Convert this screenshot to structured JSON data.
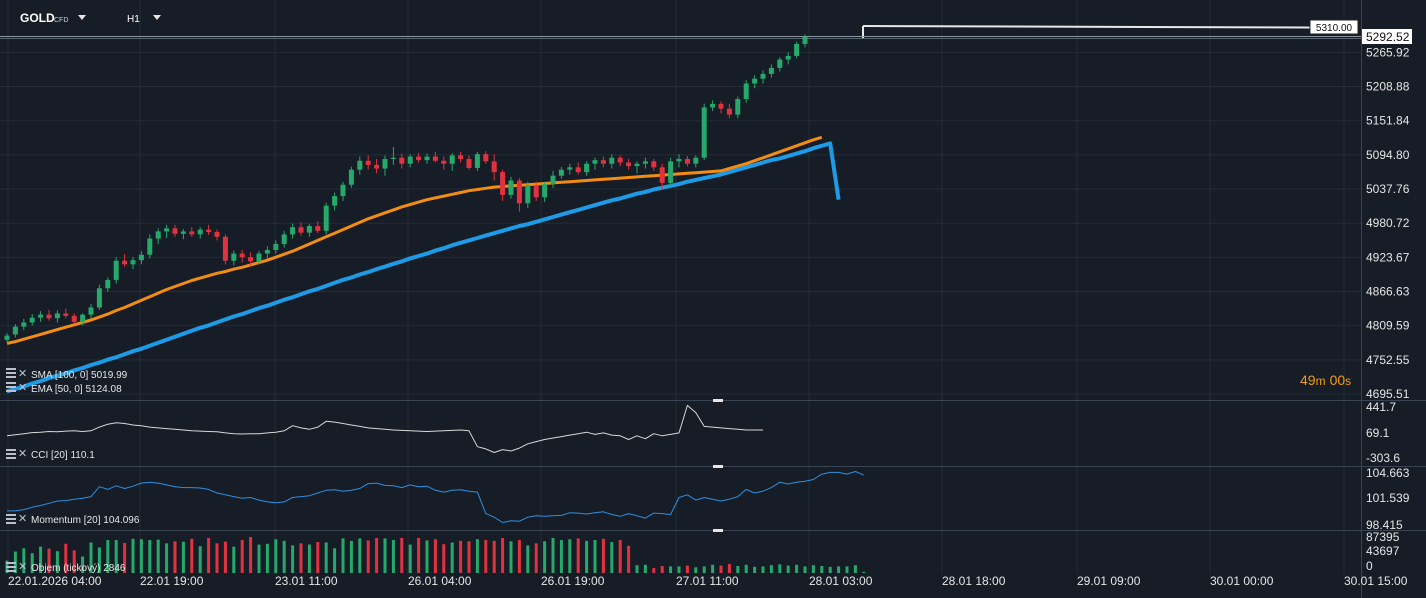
{
  "toolbar": {
    "symbol": "GOLD",
    "symbol_type": "CFD",
    "timeframe": "H1"
  },
  "colors": {
    "background": "#161d26",
    "grid": "#232c37",
    "bull": "#26a96b",
    "bear": "#e3323f",
    "sma": "#1e9be6",
    "ema": "#f38d12",
    "cci": "#d8d8d8",
    "momentum": "#2f8fe0",
    "countdown": "#f39c12"
  },
  "price_axis": {
    "ticks": [
      "5265.92",
      "5208.88",
      "5151.84",
      "5094.80",
      "5037.76",
      "4980.72",
      "4923.67",
      "4866.63",
      "4809.59",
      "4752.55",
      "4695.51"
    ],
    "current_price": "5292.52",
    "line_label": "5310.00"
  },
  "countdown": {
    "minutes": "49",
    "m": "m",
    "seconds": "00",
    "s": "s"
  },
  "indicators": {
    "sma": {
      "name": "SMA",
      "params": "[100,  0]",
      "value": "5019.99"
    },
    "ema": {
      "name": "EMA",
      "params": "[50,  0]",
      "value": "5124.08"
    },
    "cci": {
      "name": "CCI",
      "params": "[20]",
      "value": "110.1",
      "axis": [
        "441.7",
        "69.1",
        "-303.6"
      ]
    },
    "momentum": {
      "name": "Momentum",
      "params": "[20]",
      "value": "104.096",
      "axis": [
        "104.663",
        "101.539",
        "98.415"
      ]
    },
    "volume": {
      "name": "Objem  (tickový)",
      "value": "2846",
      "axis": [
        "87395",
        "43697",
        "0"
      ]
    }
  },
  "time_axis": [
    "22.01.2026  04:00",
    "22.01  19:00",
    "23.01  11:00",
    "26.01  04:00",
    "26.01  19:00",
    "27.01  11:00",
    "28.01  03:00",
    "28.01  18:00",
    "29.01  09:00",
    "30.01  00:00",
    "30.01  15:00"
  ],
  "chart_data": {
    "type": "candlestick",
    "ylim": [
      4695.51,
      5310.0
    ],
    "candles_ohlc": [
      [
        4786,
        4797,
        4782,
        4793
      ],
      [
        4795,
        4812,
        4790,
        4808
      ],
      [
        4808,
        4821,
        4802,
        4815
      ],
      [
        4815,
        4829,
        4810,
        4823
      ],
      [
        4823,
        4834,
        4816,
        4828
      ],
      [
        4828,
        4836,
        4818,
        4822
      ],
      [
        4822,
        4835,
        4815,
        4830
      ],
      [
        4830,
        4838,
        4822,
        4826
      ],
      [
        4826,
        4830,
        4812,
        4816
      ],
      [
        4816,
        4830,
        4810,
        4828
      ],
      [
        4828,
        4846,
        4822,
        4840
      ],
      [
        4840,
        4878,
        4836,
        4872
      ],
      [
        4872,
        4890,
        4866,
        4886
      ],
      [
        4886,
        4924,
        4880,
        4918
      ],
      [
        4918,
        4929,
        4908,
        4912
      ],
      [
        4912,
        4924,
        4904,
        4919
      ],
      [
        4919,
        4934,
        4912,
        4928
      ],
      [
        4928,
        4962,
        4922,
        4955
      ],
      [
        4955,
        4972,
        4946,
        4967
      ],
      [
        4967,
        4978,
        4956,
        4972
      ],
      [
        4972,
        4978,
        4958,
        4963
      ],
      [
        4963,
        4971,
        4954,
        4967
      ],
      [
        4967,
        4974,
        4958,
        4962
      ],
      [
        4962,
        4974,
        4955,
        4970
      ],
      [
        4970,
        4978,
        4961,
        4966
      ],
      [
        4966,
        4970,
        4952,
        4958
      ],
      [
        4958,
        4962,
        4912,
        4918
      ],
      [
        4918,
        4935,
        4910,
        4930
      ],
      [
        4930,
        4936,
        4915,
        4924
      ],
      [
        4924,
        4932,
        4910,
        4917
      ],
      [
        4917,
        4934,
        4912,
        4930
      ],
      [
        4930,
        4942,
        4921,
        4936
      ],
      [
        4936,
        4952,
        4930,
        4946
      ],
      [
        4946,
        4968,
        4940,
        4962
      ],
      [
        4962,
        4980,
        4955,
        4974
      ],
      [
        4974,
        4982,
        4960,
        4965
      ],
      [
        4965,
        4980,
        4958,
        4976
      ],
      [
        4976,
        4984,
        4964,
        4968
      ],
      [
        4968,
        5015,
        4962,
        5010
      ],
      [
        5010,
        5032,
        5002,
        5026
      ],
      [
        5026,
        5050,
        5018,
        5045
      ],
      [
        5045,
        5075,
        5040,
        5070
      ],
      [
        5070,
        5092,
        5062,
        5085
      ],
      [
        5085,
        5094,
        5070,
        5078
      ],
      [
        5078,
        5088,
        5064,
        5072
      ],
      [
        5072,
        5094,
        5060,
        5088
      ],
      [
        5088,
        5108,
        5078,
        5090
      ],
      [
        5090,
        5097,
        5072,
        5080
      ],
      [
        5080,
        5096,
        5074,
        5092
      ],
      [
        5092,
        5098,
        5082,
        5086
      ],
      [
        5086,
        5097,
        5080,
        5092
      ],
      [
        5092,
        5100,
        5082,
        5085
      ],
      [
        5085,
        5092,
        5070,
        5080
      ],
      [
        5080,
        5098,
        5068,
        5094
      ],
      [
        5094,
        5100,
        5082,
        5088
      ],
      [
        5088,
        5094,
        5070,
        5073
      ],
      [
        5073,
        5100,
        5068,
        5096
      ],
      [
        5096,
        5101,
        5080,
        5084
      ],
      [
        5084,
        5096,
        5052,
        5066
      ],
      [
        5066,
        5070,
        5018,
        5028
      ],
      [
        5028,
        5058,
        5022,
        5052
      ],
      [
        5052,
        5056,
        5000,
        5014
      ],
      [
        5014,
        5050,
        5006,
        5044
      ],
      [
        5044,
        5050,
        5018,
        5024
      ],
      [
        5024,
        5050,
        5016,
        5046
      ],
      [
        5046,
        5068,
        5040,
        5060
      ],
      [
        5060,
        5075,
        5055,
        5070
      ],
      [
        5070,
        5080,
        5062,
        5074
      ],
      [
        5074,
        5082,
        5062,
        5066
      ],
      [
        5066,
        5084,
        5060,
        5080
      ],
      [
        5080,
        5090,
        5070,
        5086
      ],
      [
        5086,
        5092,
        5074,
        5080
      ],
      [
        5080,
        5096,
        5072,
        5090
      ],
      [
        5090,
        5094,
        5076,
        5082
      ],
      [
        5082,
        5088,
        5070,
        5076
      ],
      [
        5076,
        5084,
        5064,
        5080
      ],
      [
        5080,
        5090,
        5072,
        5084
      ],
      [
        5084,
        5088,
        5068,
        5074
      ],
      [
        5074,
        5080,
        5038,
        5048
      ],
      [
        5048,
        5090,
        5044,
        5084
      ],
      [
        5084,
        5096,
        5074,
        5088
      ],
      [
        5088,
        5093,
        5076,
        5080
      ],
      [
        5080,
        5094,
        5074,
        5090
      ],
      [
        5090,
        5180,
        5086,
        5174
      ],
      [
        5174,
        5186,
        5168,
        5180
      ],
      [
        5180,
        5184,
        5164,
        5172
      ],
      [
        5172,
        5180,
        5156,
        5162
      ],
      [
        5162,
        5192,
        5156,
        5188
      ],
      [
        5188,
        5220,
        5182,
        5214
      ],
      [
        5214,
        5228,
        5206,
        5222
      ],
      [
        5222,
        5236,
        5214,
        5230
      ],
      [
        5230,
        5246,
        5224,
        5240
      ],
      [
        5240,
        5258,
        5234,
        5254
      ],
      [
        5254,
        5266,
        5246,
        5260
      ],
      [
        5260,
        5284,
        5256,
        5280
      ],
      [
        5280,
        5296,
        5274,
        5292
      ]
    ],
    "series": [
      {
        "name": "SMA [100,  0]",
        "values": [
          4700,
          4704,
          4708,
          4713,
          4717,
          4722,
          4726,
          4730,
          4735,
          4739,
          4744,
          4748,
          4753,
          4757,
          4762,
          4767,
          4771,
          4776,
          4781,
          4786,
          4791,
          4796,
          4801,
          4806,
          4810,
          4815,
          4820,
          4825,
          4829,
          4834,
          4839,
          4843,
          4848,
          4853,
          4857,
          4862,
          4867,
          4871,
          4876,
          4881,
          4886,
          4890,
          4895,
          4899,
          4904,
          4908,
          4913,
          4917,
          4922,
          4926,
          4930,
          4935,
          4939,
          4944,
          4948,
          4952,
          4956,
          4960,
          4964,
          4968,
          4972,
          4976,
          4979,
          4983,
          4987,
          4991,
          4995,
          4999,
          5003,
          5007,
          5011,
          5015,
          5019,
          5022,
          5026,
          5030,
          5033,
          5037,
          5040,
          5043,
          5046,
          5050,
          5053,
          5056,
          5059,
          5062,
          5066,
          5070,
          5074,
          5078,
          5082,
          5086,
          5089,
          5093,
          5097,
          5101,
          5106,
          5110,
          5114,
          5019.99
        ]
      },
      {
        "name": "EMA [50,  0]",
        "values": [
          4780,
          4783,
          4787,
          4791,
          4795,
          4799,
          4803,
          4807,
          4811,
          4815,
          4819,
          4824,
          4829,
          4835,
          4840,
          4846,
          4852,
          4858,
          4864,
          4870,
          4875,
          4880,
          4885,
          4889,
          4893,
          4897,
          4900,
          4904,
          4907,
          4911,
          4915,
          4919,
          4924,
          4929,
          4934,
          4940,
          4946,
          4952,
          4958,
          4964,
          4970,
          4976,
          4982,
          4988,
          4993,
          4998,
          5003,
          5008,
          5012,
          5016,
          5020,
          5023,
          5026,
          5029,
          5032,
          5035,
          5037,
          5039,
          5041,
          5042,
          5043,
          5044,
          5045,
          5046,
          5047,
          5048,
          5049,
          5050,
          5051,
          5052,
          5053,
          5054,
          5055,
          5056,
          5057,
          5058,
          5059,
          5060,
          5061,
          5062,
          5063,
          5064,
          5065,
          5066,
          5067,
          5068,
          5072,
          5076,
          5080,
          5085,
          5090,
          5095,
          5100,
          5105,
          5110,
          5115,
          5120,
          5124.08
        ]
      },
      {
        "name": "CCI [20]",
        "values": [
          30,
          45,
          60,
          75,
          80,
          90,
          85,
          95,
          100,
          90,
          100,
          150,
          190,
          210,
          200,
          180,
          170,
          150,
          140,
          130,
          120,
          110,
          100,
          95,
          90,
          85,
          70,
          60,
          55,
          60,
          60,
          70,
          80,
          100,
          170,
          140,
          120,
          150,
          230,
          220,
          200,
          180,
          160,
          140,
          130,
          120,
          110,
          105,
          100,
          95,
          90,
          95,
          100,
          105,
          110,
          100,
          -120,
          -150,
          -200,
          -160,
          -180,
          -140,
          -80,
          -50,
          -20,
          0,
          20,
          40,
          60,
          80,
          50,
          70,
          40,
          30,
          -20,
          30,
          -10,
          60,
          30,
          50,
          70,
          450,
          350,
          160,
          150,
          140,
          130,
          120,
          110,
          110,
          110.1
        ]
      },
      {
        "name": "Momentum [20]",
        "values": [
          100.1,
          100.1,
          100.25,
          100.5,
          100.7,
          100.95,
          101.2,
          101.25,
          101.4,
          101.5,
          101.7,
          102.8,
          102.5,
          102.9,
          102.6,
          102.85,
          103.2,
          103.3,
          103.2,
          103.0,
          102.8,
          102.7,
          102.7,
          102.65,
          102.5,
          102.1,
          101.9,
          101.7,
          101.5,
          101.6,
          101.3,
          101.1,
          101.0,
          101.1,
          101.6,
          101.7,
          101.8,
          102.1,
          102.4,
          102.45,
          102.3,
          102.4,
          102.6,
          103.15,
          103.2,
          102.95,
          102.9,
          102.7,
          103.0,
          102.8,
          102.85,
          102.4,
          102.2,
          102.4,
          102.45,
          102.3,
          102.2,
          99.8,
          99.4,
          98.8,
          99.0,
          98.95,
          99.4,
          99.55,
          99.5,
          99.55,
          99.6,
          99.9,
          99.85,
          99.75,
          99.9,
          100.0,
          99.7,
          99.5,
          99.8,
          99.55,
          99.3,
          99.85,
          99.8,
          99.7,
          101.6,
          101.9,
          101.3,
          101.6,
          101.4,
          101.2,
          101.4,
          101.7,
          102.5,
          102.1,
          102.3,
          102.7,
          103.3,
          103.1,
          103.3,
          103.4,
          103.6,
          104.2,
          104.4,
          104.4,
          104.2,
          104.5,
          104.096
        ]
      },
      {
        "name": "Objem (tickový)",
        "values": [
          30000,
          52000,
          60000,
          48000,
          64000,
          59000,
          53000,
          71000,
          55000,
          40000,
          74000,
          62000,
          80000,
          80000,
          73000,
          83000,
          82000,
          80000,
          81000,
          72000,
          77000,
          76000,
          83000,
          65000,
          85000,
          72000,
          76000,
          64000,
          80000,
          87395,
          69000,
          71000,
          82000,
          78000,
          67000,
          72000,
          69000,
          75000,
          74000,
          60000,
          84000,
          78000,
          84000,
          79000,
          85000,
          84000,
          80000,
          85000,
          69000,
          85000,
          79000,
          82000,
          70000,
          74000,
          78000,
          77000,
          82000,
          80000,
          78000,
          85000,
          77000,
          80000,
          67000,
          72000,
          77000,
          85000,
          80000,
          82000,
          84000,
          78000,
          80000,
          83000,
          75000,
          80000,
          66000,
          19000,
          20000,
          12000,
          17000,
          16000,
          16000,
          18000,
          14000,
          16000,
          20000,
          18000,
          22000,
          17000,
          20000,
          15000,
          16000,
          19000,
          21000,
          18000,
          20000,
          16000,
          19000,
          17000,
          15000,
          16000,
          16000,
          19000,
          2846
        ]
      }
    ]
  }
}
